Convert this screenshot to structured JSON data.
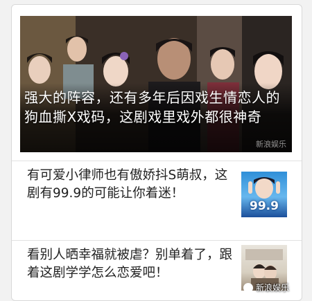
{
  "feature": {
    "title": "强大的阵容，还有多年后因戏生情恋人的狗血撕X戏码，这剧戏里戏外都很神奇",
    "watermark": "新浪娱乐"
  },
  "articles": [
    {
      "title": "有可爱小律师也有傲娇抖S萌叔，这剧有99.9的可能让你着迷！",
      "thumb_text": "99.9"
    },
    {
      "title": "看别人晒幸福就被虐？别单着了，跟着这剧学学怎么恋爱吧！",
      "thumb_text": ""
    }
  ],
  "watermark": "新浪娱乐"
}
